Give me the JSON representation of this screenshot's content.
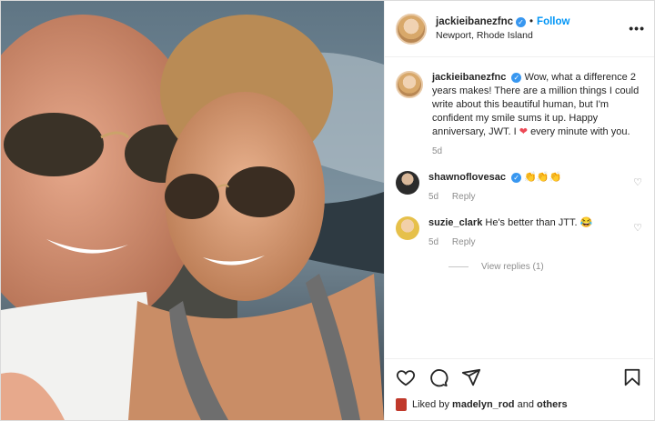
{
  "post": {
    "username": "jackieibanezfnc",
    "follow_label": "Follow",
    "location": "Newport, Rhode Island",
    "more_glyph": "•••",
    "verified_glyph": "✓"
  },
  "caption": {
    "username": "jackieibanezfnc",
    "text_before_heart": "Wow, what a difference 2 years makes! There are a million things I could write about this beautiful human, but I'm confident my smile sums it up. Happy anniversary, JWT. I",
    "heart_glyph": "❤",
    "text_after_heart": "every minute with you.",
    "time": "5d"
  },
  "comments": [
    {
      "username": "shawnoflovesac",
      "text": "👏👏👏",
      "time": "5d",
      "reply_label": "Reply"
    },
    {
      "username": "suzie_clark",
      "text": "He's better than JTT. 😂",
      "time": "5d",
      "reply_label": "Reply"
    }
  ],
  "view_replies_label": "View replies (1)",
  "likes": {
    "prefix": "Liked by",
    "user": "madelyn_rod",
    "connector": "and",
    "others": "others"
  },
  "icons": {
    "comment_like": "♡",
    "dot": "•"
  }
}
